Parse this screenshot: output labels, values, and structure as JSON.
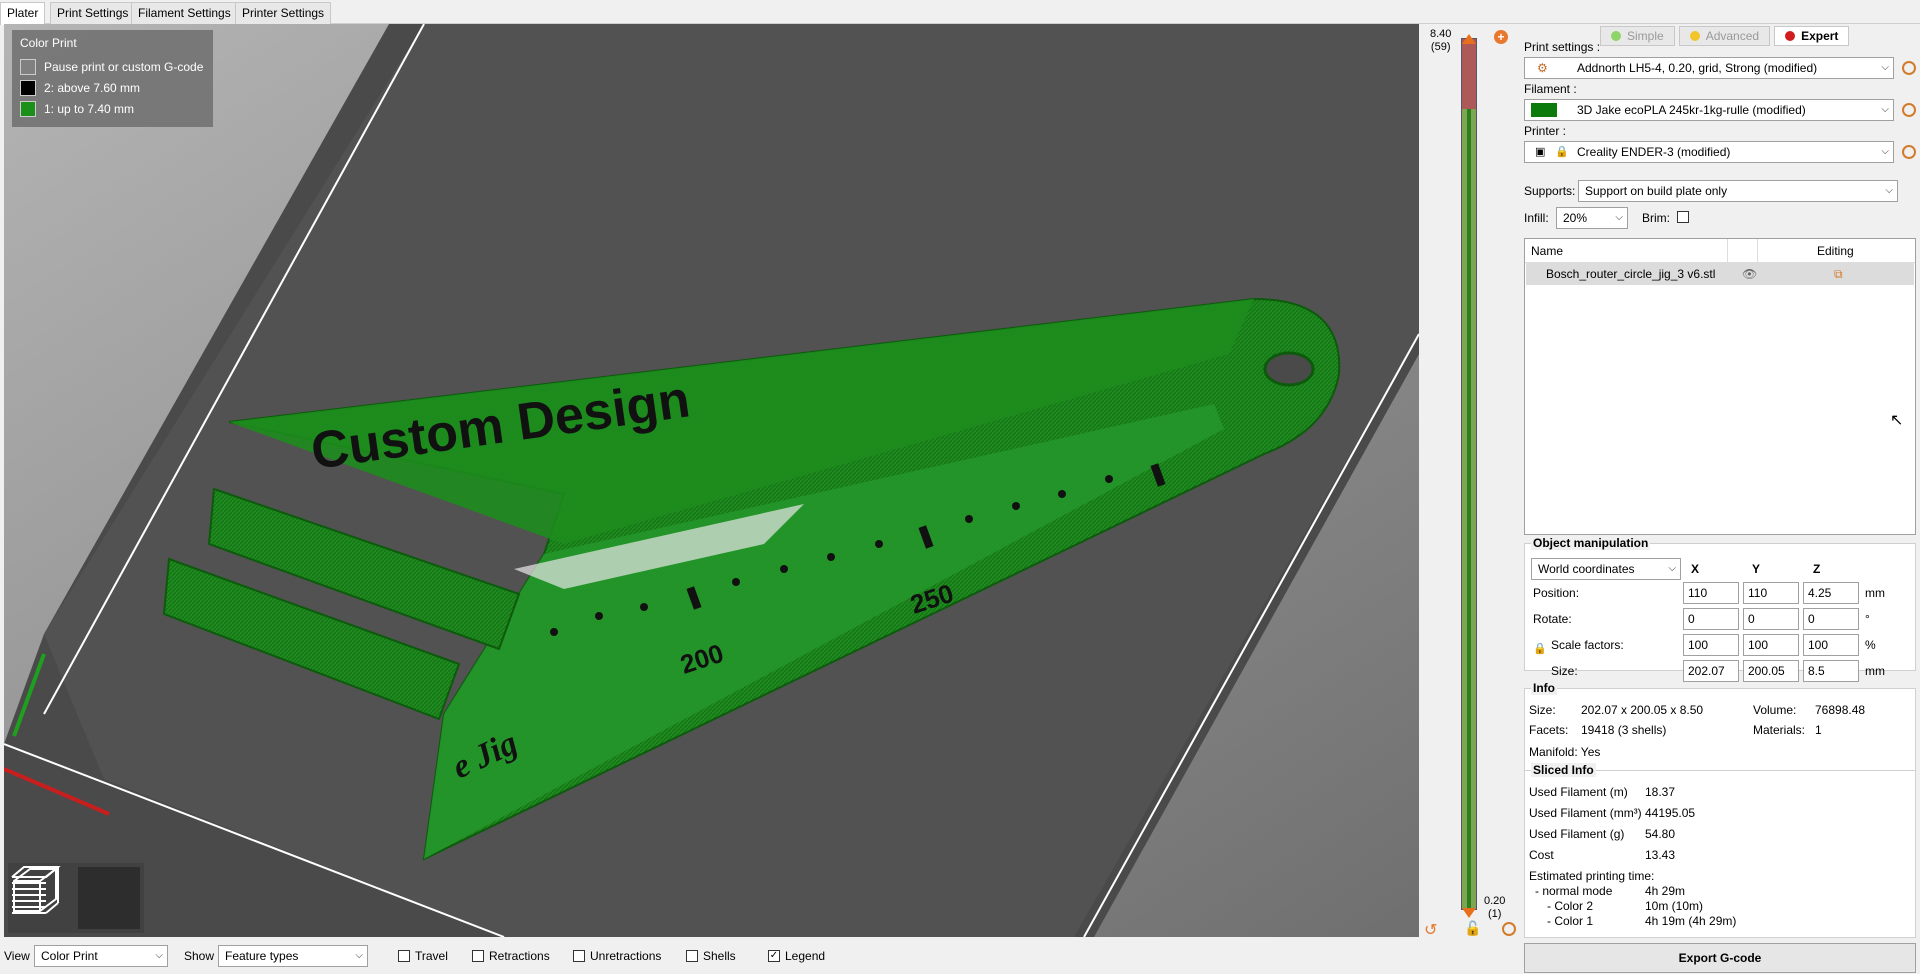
{
  "tabs": [
    "Plater",
    "Print Settings",
    "Filament Settings",
    "Printer Settings"
  ],
  "legend": {
    "title": "Color Print",
    "items": [
      {
        "label": "Pause print or custom G-code",
        "color": "#808080"
      },
      {
        "label": "2: above 7.60 mm",
        "color": "#000000"
      },
      {
        "label": "1: up to 7.40 mm",
        "color": "#1a8f1a"
      }
    ]
  },
  "model_text": {
    "title": "Custom Design",
    "n200": "200",
    "n250": "250",
    "jig": "e Jig"
  },
  "slider": {
    "top_value": "8.40",
    "top_layer": "(59)",
    "bottom_value": "0.20",
    "bottom_layer": "(1)"
  },
  "modes": {
    "simple": "Simple",
    "advanced": "Advanced",
    "expert": "Expert"
  },
  "print_settings": {
    "label": "Print settings :",
    "value": "Addnorth LH5-4, 0.20, grid, Strong (modified)"
  },
  "filament": {
    "label": "Filament :",
    "value": "3D Jake ecoPLA 245kr-1kg-rulle (modified)",
    "color": "#0b7c0b"
  },
  "printer": {
    "label": "Printer :",
    "value": "Creality ENDER-3 (modified)"
  },
  "supports": {
    "label": "Supports:",
    "value": "Support on build plate only"
  },
  "infill": {
    "label": "Infill:",
    "value": "20%"
  },
  "brim": {
    "label": "Brim:"
  },
  "object_list": {
    "col_name": "Name",
    "col_editing": "Editing",
    "object": "Bosch_router_circle_jig_3 v6.stl"
  },
  "manipulation": {
    "title": "Object manipulation",
    "coords": "World coordinates",
    "x": "X",
    "y": "Y",
    "z": "Z",
    "position": {
      "label": "Position:",
      "x": "110",
      "y": "110",
      "z": "4.25",
      "unit": "mm"
    },
    "rotate": {
      "label": "Rotate:",
      "x": "0",
      "y": "0",
      "z": "0",
      "unit": "°"
    },
    "scale": {
      "label": "Scale factors:",
      "x": "100",
      "y": "100",
      "z": "100",
      "unit": "%"
    },
    "size": {
      "label": "Size:",
      "x": "202.07",
      "y": "200.05",
      "z": "8.5",
      "unit": "mm"
    }
  },
  "info": {
    "title": "Info",
    "size_label": "Size:",
    "size": "202.07 x 200.05 x 8.50",
    "volume_label": "Volume:",
    "volume": "76898.48",
    "facets_label": "Facets:",
    "facets": "19418 (3 shells)",
    "materials_label": "Materials:",
    "materials": "1",
    "manifold": "Manifold: Yes"
  },
  "sliced": {
    "title": "Sliced Info",
    "rows": [
      {
        "label": "Used Filament (m)",
        "value": "18.37"
      },
      {
        "label": "Used Filament (mm³)",
        "value": "44195.05"
      },
      {
        "label": "Used Filament (g)",
        "value": "54.80"
      },
      {
        "label": "Cost",
        "value": "13.43"
      }
    ],
    "time_label": "Estimated printing time:",
    "normal_mode": "- normal mode",
    "normal_time": "4h 29m",
    "color2": "- Color 2",
    "color2_time": "10m (10m)",
    "color1": "- Color 1",
    "color1_time": "4h 19m (4h 29m)"
  },
  "export_label": "Export G-code",
  "bottom": {
    "view_label": "View",
    "view_value": "Color Print",
    "show_label": "Show",
    "show_value": "Feature types",
    "travel": "Travel",
    "retractions": "Retractions",
    "unretractions": "Unretractions",
    "shells": "Shells",
    "legend": "Legend"
  }
}
